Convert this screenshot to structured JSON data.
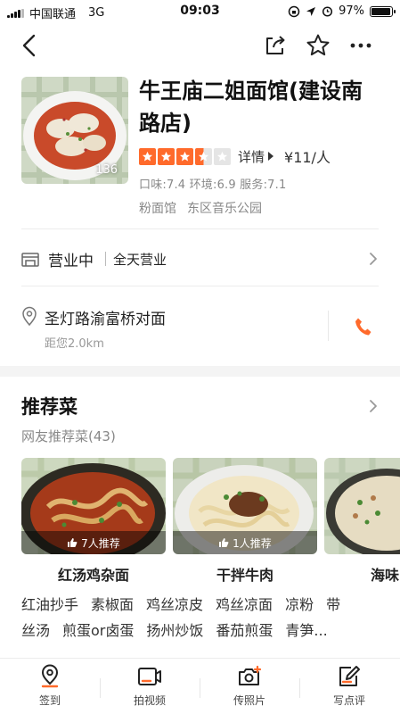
{
  "status_bar": {
    "carrier": "中国联通",
    "network": "3G",
    "time": "09:03",
    "battery": "97%",
    "battery_level": 0.97
  },
  "nav": {
    "back_icon": "chevron-left-icon",
    "share_icon": "share-icon",
    "favorite_icon": "star-outline-icon",
    "more_icon": "more-icon"
  },
  "shop": {
    "name": "牛王庙二姐面馆(建设南路店)",
    "photo_count": "136",
    "rating_stars": 3.5,
    "details_label": "详情",
    "price": "¥11/人",
    "scores": "口味:7.4  环境:6.9  服务:7.1",
    "tags": [
      "粉面馆",
      "东区音乐公园"
    ]
  },
  "hours": {
    "status": "营业中",
    "text": "全天营业"
  },
  "address": {
    "text": "圣灯路渝富桥对面",
    "distance": "距您2.0km"
  },
  "recommended": {
    "title": "推荐菜",
    "subtitle": "网友推荐菜(43)",
    "dishes": [
      {
        "name": "红汤鸡杂面",
        "recommend": "7人推荐"
      },
      {
        "name": "干拌牛肉",
        "recommend": "1人推荐"
      },
      {
        "name": "海味",
        "recommend": ""
      }
    ],
    "chips_row1": [
      "红油抄手",
      "素椒面",
      "鸡丝凉皮",
      "鸡丝凉面",
      "凉粉",
      "带"
    ],
    "chips_row2": [
      "丝汤",
      "煎蛋or卤蛋",
      "扬州炒饭",
      "番茄煎蛋",
      "青笋..."
    ]
  },
  "tabbar": {
    "checkin": "签到",
    "video": "拍视频",
    "photo": "传照片",
    "review": "写点评"
  },
  "colors": {
    "accent": "#ff6a2b",
    "text": "#222222",
    "muted": "#888888"
  }
}
